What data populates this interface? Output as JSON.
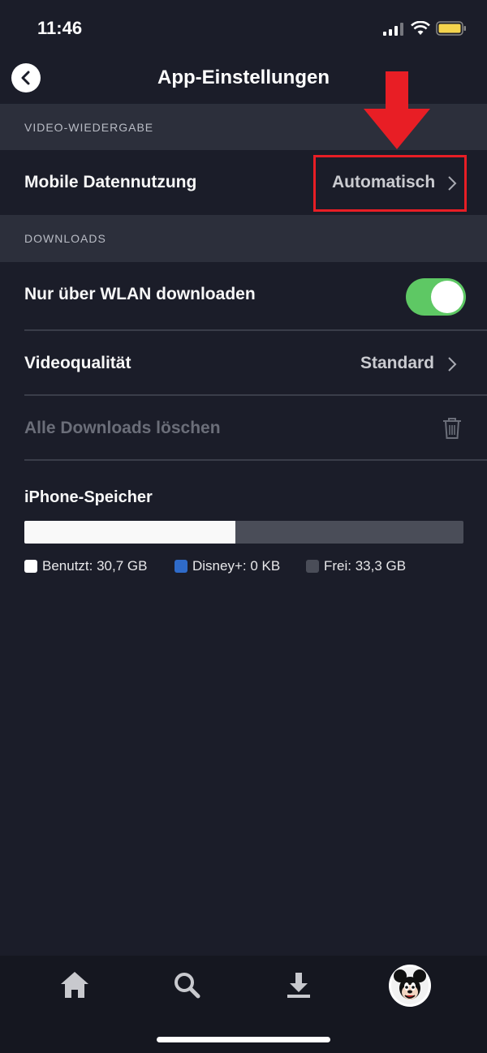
{
  "status": {
    "time": "11:46"
  },
  "header": {
    "title": "App-Einstellungen"
  },
  "sections": {
    "video": "VIDEO-WIEDERGABE",
    "downloads": "DOWNLOADS"
  },
  "rows": {
    "mobile_data": {
      "label": "Mobile Datennutzung",
      "value": "Automatisch"
    },
    "wifi_only": {
      "label": "Nur über WLAN downloaden",
      "enabled": true
    },
    "quality": {
      "label": "Videoqualität",
      "value": "Standard"
    },
    "delete_all": {
      "label": "Alle Downloads löschen"
    }
  },
  "storage": {
    "title": "iPhone-Speicher",
    "used_fraction": 0.48,
    "legend": [
      {
        "label": "Benutzt: 30,7 GB",
        "color": "#ffffff"
      },
      {
        "label": "Disney+: 0 KB",
        "color": "#2f6bc9"
      },
      {
        "label": "Frei: 33,3 GB",
        "color": "#4a4d58"
      }
    ]
  },
  "colors": {
    "accent": "#5ec864",
    "highlight": "#e81e25",
    "background": "#1b1d29"
  },
  "tabbar": {
    "icons": [
      "home-icon",
      "search-icon",
      "download-icon",
      "profile-avatar"
    ]
  }
}
